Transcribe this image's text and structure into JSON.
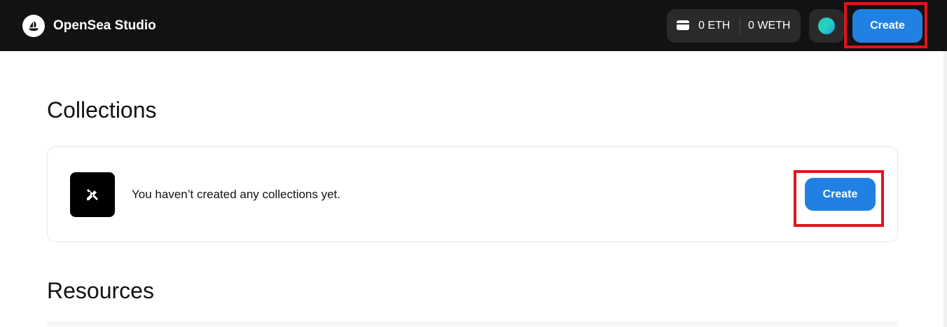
{
  "header": {
    "brand": "OpenSea Studio",
    "wallet": {
      "eth": "0 ETH",
      "weth": "0 WETH"
    },
    "create_label": "Create"
  },
  "collections": {
    "title": "Collections",
    "empty_message": "You haven’t created any collections yet.",
    "create_label": "Create"
  },
  "resources": {
    "title": "Resources"
  },
  "colors": {
    "topbar": "#121212",
    "accent": "#2081e2",
    "highlight": "#e0141e"
  },
  "icons": {
    "logo": "opensea-logo-icon",
    "wallet": "wallet-icon",
    "avatar": "avatar",
    "empty": "pencil-ruler-icon"
  }
}
